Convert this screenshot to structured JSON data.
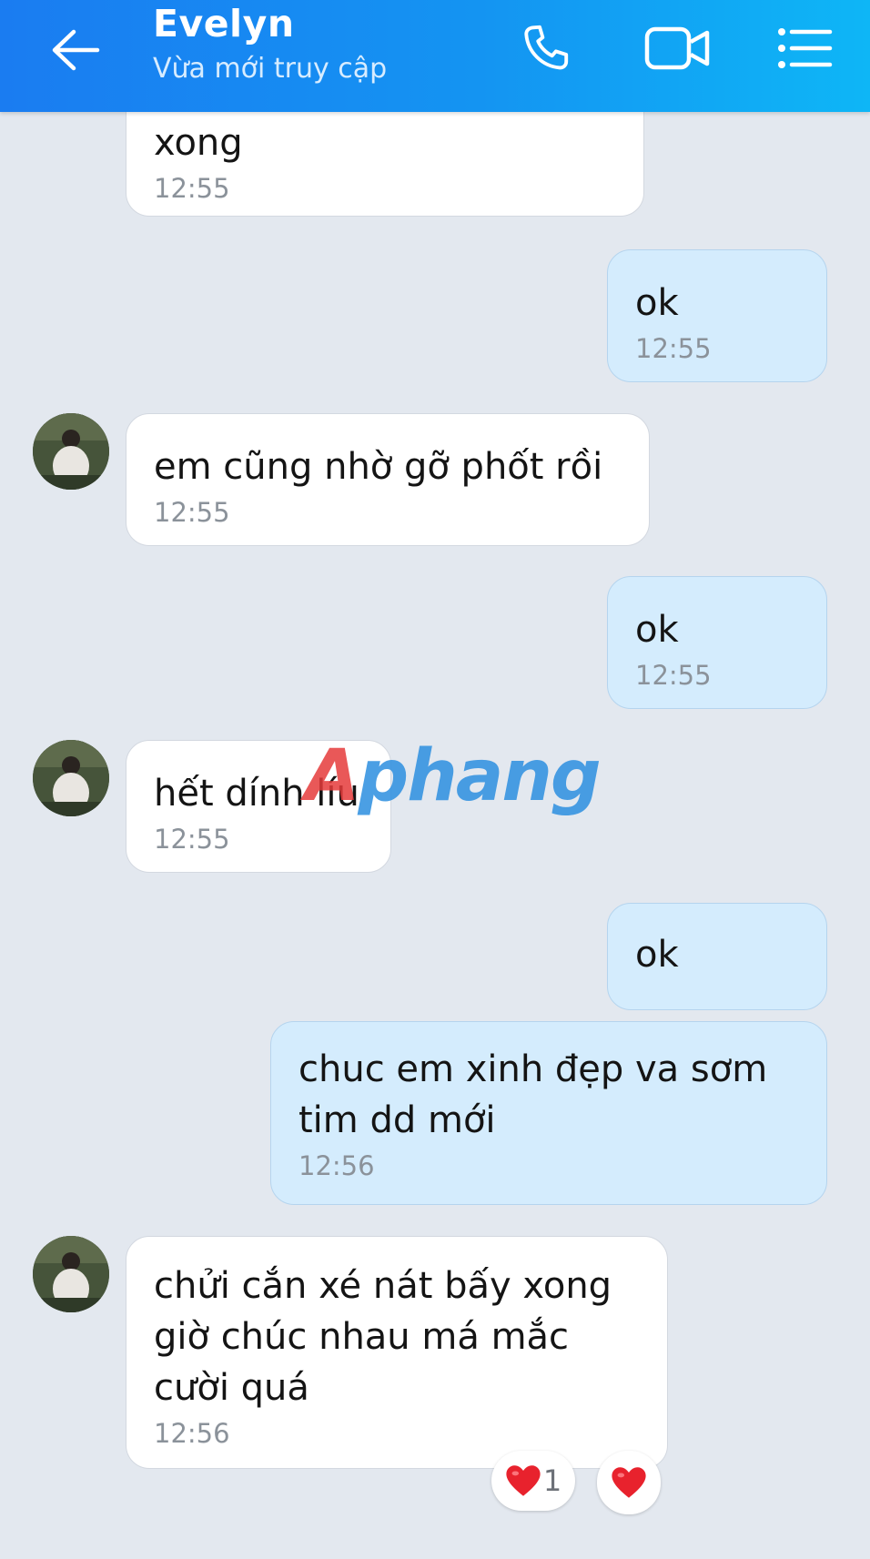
{
  "header": {
    "contact_name": "Evelyn",
    "status": "Vừa mới truy cập",
    "icons": [
      "back-arrow-icon",
      "phone-icon",
      "video-camera-icon",
      "menu-list-icon"
    ]
  },
  "messages": [
    {
      "from": "contact",
      "text": "xong",
      "time": "12:55"
    },
    {
      "from": "me",
      "text": "ok",
      "time": "12:55"
    },
    {
      "from": "contact",
      "text": "em cũng nhờ gỡ phốt rồi",
      "time": "12:55"
    },
    {
      "from": "me",
      "text": "ok",
      "time": "12:55"
    },
    {
      "from": "contact",
      "text": "hết dính líu",
      "time": "12:55"
    },
    {
      "from": "me",
      "text": "ok",
      "time": ""
    },
    {
      "from": "me",
      "text": "chuc em xinh đẹp va sơm tim dd mới",
      "time": "12:56"
    },
    {
      "from": "contact",
      "text": "chửi cắn xé nát bấy xong giờ chúc nhau má mắc cười quá",
      "time": "12:56"
    }
  ],
  "reactions": {
    "count": "1",
    "icon": "heart-icon",
    "color": "#e8222d"
  },
  "watermark": {
    "part1": "A",
    "part2": "phang",
    "colors": [
      "#e63b3b",
      "#2c8fe0"
    ]
  },
  "colors": {
    "header_start": "#1a7cf1",
    "header_end": "#0eb6f6",
    "background": "#e3e8ef",
    "incoming_bubble": "#ffffff",
    "outgoing_bubble": "#d4ecfd"
  }
}
